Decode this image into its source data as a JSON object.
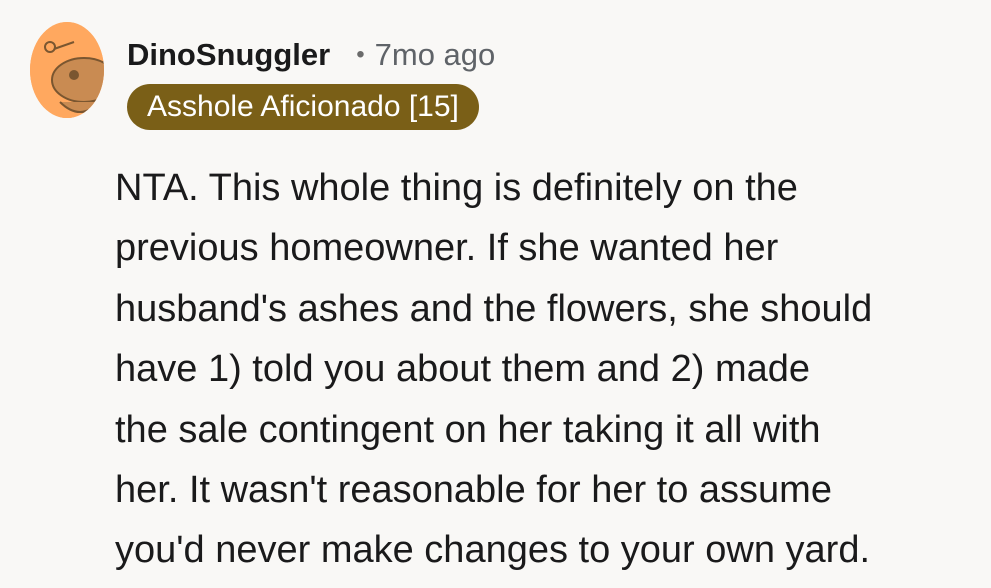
{
  "comment": {
    "author": "DinoSnuggler",
    "separator": "•",
    "time_ago": "7mo ago",
    "flair": "Asshole Aficionado [15]",
    "avatar_icon": "snoo-avatar-icon",
    "colors": {
      "avatar_bg": "#ffa85f",
      "flair_bg": "#7a5f17",
      "flair_text": "#ffffff"
    },
    "body_lines": [
      "NTA. This whole thing is definitely on the",
      "previous homeowner. If she wanted her",
      "husband's ashes and the flowers, she should",
      "have 1) told you about them and 2) made",
      "the sale contingent on her taking it all with",
      "her. It wasn't reasonable for her to assume",
      "you'd never make changes to your own yard."
    ]
  }
}
